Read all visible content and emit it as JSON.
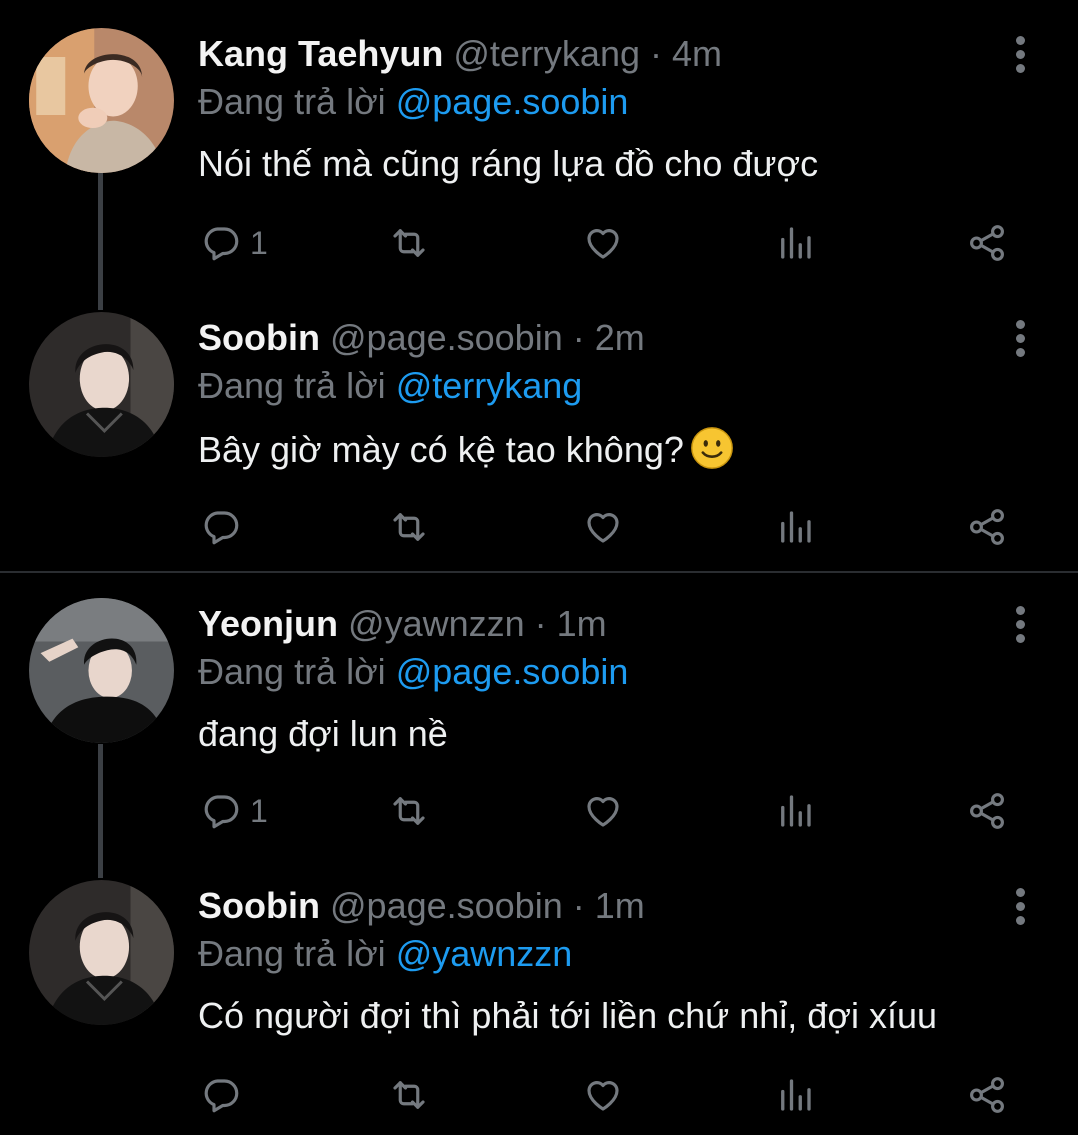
{
  "tweets": [
    {
      "name": "Kang Taehyun",
      "handle": "@terrykang",
      "time": "4m",
      "reply_prefix": "Đang trả lời",
      "reply_to": "@page.soobin",
      "text": "Nói thế mà cũng ráng lựa đồ cho được",
      "reply_count": "1",
      "avatar_icon": "avatar-photo"
    },
    {
      "name": "Soobin",
      "handle": "@page.soobin",
      "time": "2m",
      "reply_prefix": "Đang trả lời",
      "reply_to": "@terrykang",
      "text": "Bây giờ mày có kệ tao không?",
      "emoji": "slightly-smiling-face",
      "reply_count": "",
      "avatar_icon": "avatar-photo"
    },
    {
      "name": "Yeonjun",
      "handle": "@yawnzzn",
      "time": "1m",
      "reply_prefix": "Đang trả lời",
      "reply_to": "@page.soobin",
      "text": "đang đợi lun nề",
      "reply_count": "1",
      "avatar_icon": "avatar-photo"
    },
    {
      "name": "Soobin",
      "handle": "@page.soobin",
      "time": "1m",
      "reply_prefix": "Đang trả lời",
      "reply_to": "@yawnzzn",
      "text": "Có người đợi thì phải tới liền chứ nhỉ, đợi xíuu",
      "reply_count": "",
      "avatar_icon": "avatar-photo"
    }
  ],
  "separator": " · ",
  "colors": {
    "background": "#000000",
    "muted": "#74797f",
    "mention": "#1d9bf0"
  },
  "icons": [
    "reply-icon",
    "retweet-icon",
    "like-icon",
    "views-icon",
    "share-icon",
    "more-icon"
  ]
}
